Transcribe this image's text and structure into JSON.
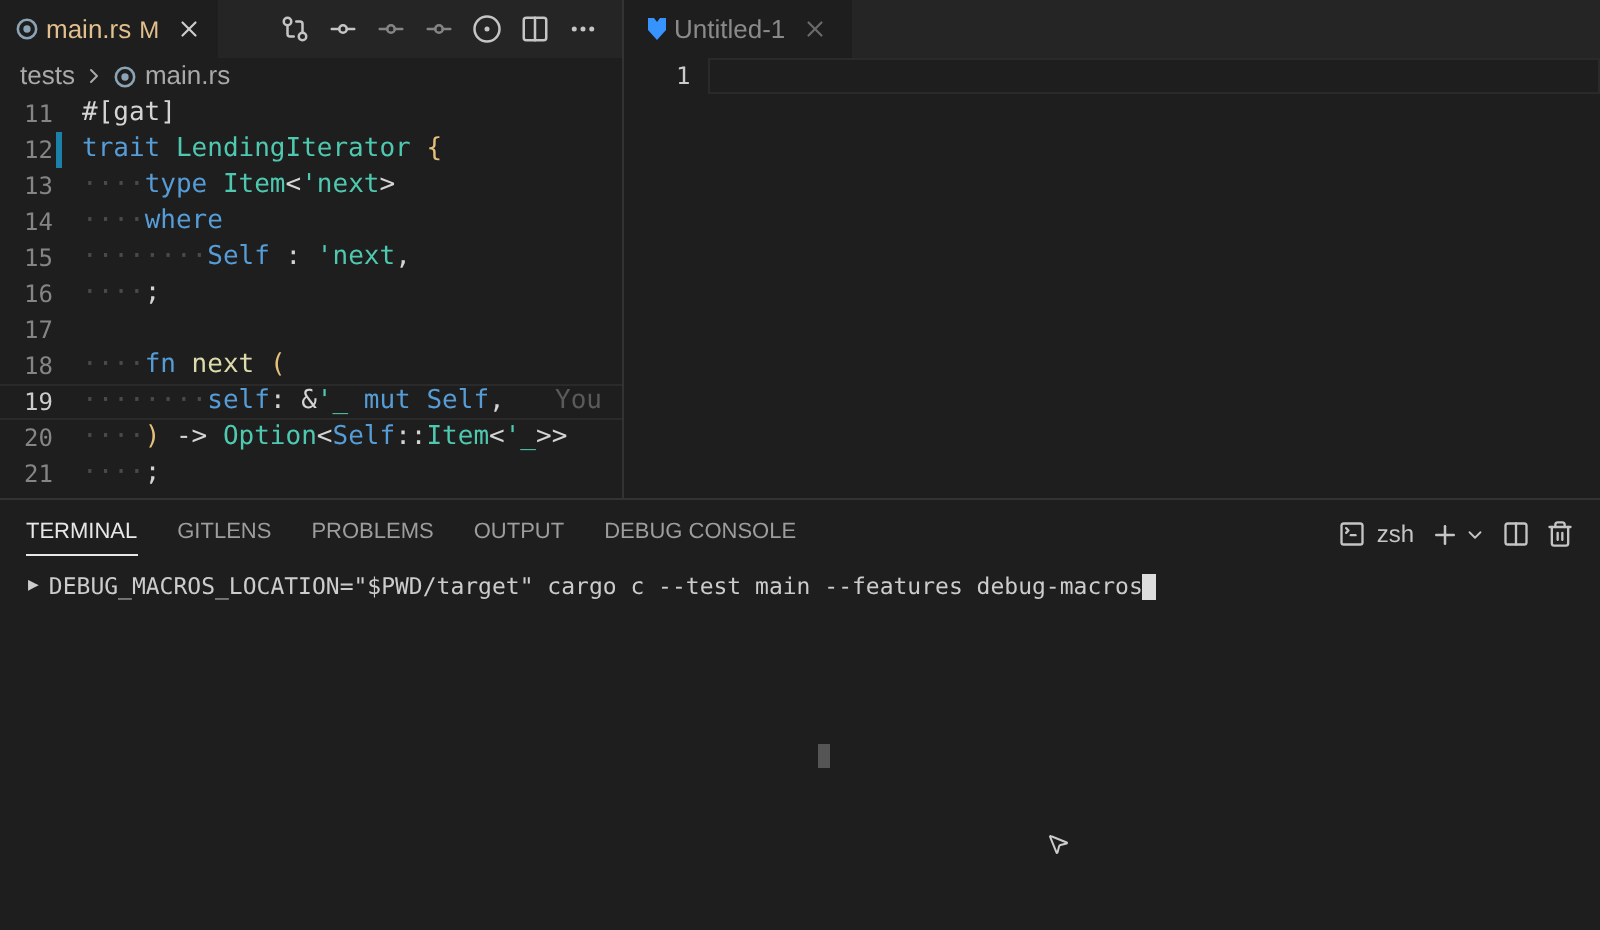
{
  "left_editor": {
    "tab": {
      "label": "main.rs",
      "badge": "M",
      "selected": true
    },
    "breadcrumbs": [
      "tests",
      "main.rs"
    ],
    "lines": [
      {
        "number": "11",
        "current": false,
        "modified": false,
        "tokens": [
          {
            "text": "#[gat]",
            "kind": "plain"
          }
        ]
      },
      {
        "number": "12",
        "current": false,
        "modified": true,
        "tokens": [
          {
            "text": "trait",
            "kind": "keyword"
          },
          {
            "text": " LendingIterator ",
            "kind": "type"
          },
          {
            "text": "{",
            "kind": "bracket"
          }
        ]
      },
      {
        "number": "13",
        "current": false,
        "modified": false,
        "tokens": [
          {
            "text": "····",
            "kind": "ws"
          },
          {
            "text": "type",
            "kind": "keyword"
          },
          {
            "text": " Item",
            "kind": "type"
          },
          {
            "text": "<",
            "kind": "plain"
          },
          {
            "text": "'next",
            "kind": "type"
          },
          {
            "text": ">",
            "kind": "plain"
          }
        ]
      },
      {
        "number": "14",
        "current": false,
        "modified": false,
        "tokens": [
          {
            "text": "····",
            "kind": "ws"
          },
          {
            "text": "where",
            "kind": "keyword"
          }
        ]
      },
      {
        "number": "15",
        "current": false,
        "modified": false,
        "tokens": [
          {
            "text": "········",
            "kind": "ws"
          },
          {
            "text": "Self",
            "kind": "keyword"
          },
          {
            "text": " : ",
            "kind": "plain"
          },
          {
            "text": "'next",
            "kind": "type"
          },
          {
            "text": ",",
            "kind": "plain"
          }
        ]
      },
      {
        "number": "16",
        "current": false,
        "modified": false,
        "tokens": [
          {
            "text": "····",
            "kind": "ws"
          },
          {
            "text": ";",
            "kind": "plain"
          }
        ]
      },
      {
        "number": "17",
        "current": false,
        "modified": false
      },
      {
        "number": "18",
        "current": false,
        "modified": false,
        "tokens": [
          {
            "text": "····",
            "kind": "ws"
          },
          {
            "text": "fn",
            "kind": "keyword"
          },
          {
            "text": " next ",
            "kind": "func"
          },
          {
            "text": "(",
            "kind": "bracket"
          }
        ]
      },
      {
        "number": "19",
        "current": true,
        "modified": false,
        "tokens": [
          {
            "text": "········",
            "kind": "ws"
          },
          {
            "text": "self",
            "kind": "keyword"
          },
          {
            "text": ": &",
            "kind": "plain"
          },
          {
            "text": "'_",
            "kind": "type"
          },
          {
            "text": " mut ",
            "kind": "keyword"
          },
          {
            "text": "Self",
            "kind": "keyword"
          },
          {
            "text": ",",
            "kind": "plain"
          }
        ],
        "blame": "You"
      },
      {
        "number": "20",
        "current": false,
        "modified": false,
        "tokens": [
          {
            "text": "····",
            "kind": "ws"
          },
          {
            "text": ")",
            "kind": "bracket"
          },
          {
            "text": " -> ",
            "kind": "plain"
          },
          {
            "text": "Option",
            "kind": "type"
          },
          {
            "text": "<",
            "kind": "plain"
          },
          {
            "text": "Self",
            "kind": "keyword"
          },
          {
            "text": "::",
            "kind": "plain"
          },
          {
            "text": "Item",
            "kind": "type"
          },
          {
            "text": "<",
            "kind": "plain"
          },
          {
            "text": "'_",
            "kind": "type"
          },
          {
            "text": ">>",
            "kind": "plain"
          }
        ]
      },
      {
        "number": "21",
        "current": false,
        "modified": false,
        "tokens": [
          {
            "text": "····",
            "kind": "ws"
          },
          {
            "text": ";",
            "kind": "plain"
          }
        ]
      }
    ]
  },
  "right_editor": {
    "tab": {
      "label": "Untitled-1",
      "selected": false
    },
    "lines": [
      {
        "number": "1"
      }
    ]
  },
  "panel": {
    "tabs": [
      {
        "label": "TERMINAL",
        "selected": true
      },
      {
        "label": "GITLENS",
        "selected": false
      },
      {
        "label": "PROBLEMS",
        "selected": false
      },
      {
        "label": "OUTPUT",
        "selected": false
      },
      {
        "label": "DEBUG CONSOLE",
        "selected": false
      }
    ],
    "shell": "zsh",
    "prompt": "▶",
    "command": "DEBUG_MACROS_LOCATION=\"$PWD/target\" cargo c --test main --features debug-macros"
  }
}
